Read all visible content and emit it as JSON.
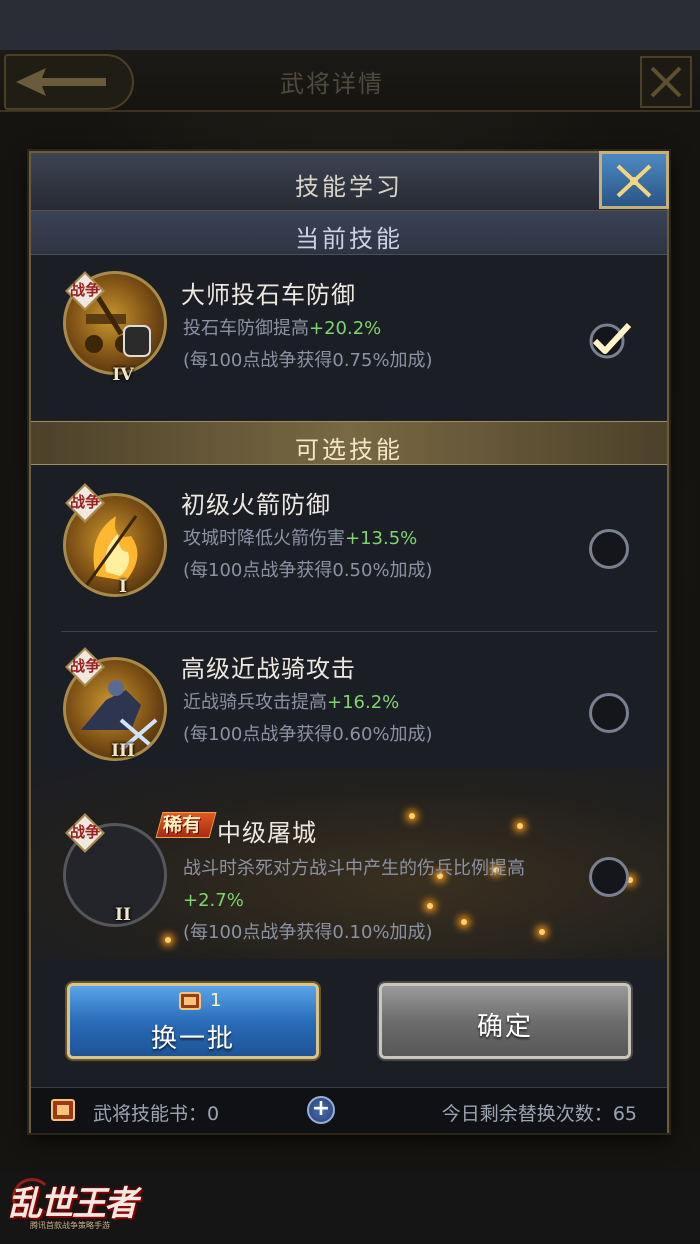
{
  "background": {
    "header_title": "武将详情"
  },
  "logo": {
    "title": "乱世王者",
    "subtitle": "腾讯首款战争策略手游"
  },
  "dialog": {
    "title": "技能学习",
    "current_section": "当前技能",
    "optional_section": "可选技能",
    "current_skill": {
      "tag": "战争",
      "level": "IV",
      "name": "大师投石车防御",
      "desc_prefix": "投石车防御提高",
      "desc_value": "+20.2%",
      "bonus": "(每100点战争获得0.75%加成)",
      "selected": true
    },
    "options": [
      {
        "tag": "战争",
        "level": "I",
        "name": "初级火箭防御",
        "desc_prefix": "攻城时降低火箭伤害",
        "desc_value": "+13.5%",
        "bonus": "(每100点战争获得0.50%加成)",
        "selected": false
      },
      {
        "tag": "战争",
        "level": "III",
        "name": "高级近战骑攻击",
        "desc_prefix": "近战骑兵攻击提高",
        "desc_value": "+16.2%",
        "bonus": "(每100点战争获得0.60%加成)",
        "selected": false
      },
      {
        "tag": "战争",
        "level": "II",
        "badge": "稀有",
        "name": "中级屠城",
        "desc_prefix": "战斗时杀死对方战斗中产生的伤兵比例提高",
        "desc_value": "+2.7%",
        "bonus": "(每100点战争获得0.10%加成)",
        "selected": false
      }
    ],
    "swap_button": "换一批",
    "swap_cost": "1",
    "confirm_button": "确定",
    "footer": {
      "books_label": "武将技能书：",
      "books_count": "0",
      "remaining_label": "今日剩余替换次数：",
      "remaining_count": "65"
    }
  },
  "colors": {
    "highlight": "#7fd46b",
    "gold_border": "#c7b07a",
    "close_blue": "#3b74b0"
  }
}
